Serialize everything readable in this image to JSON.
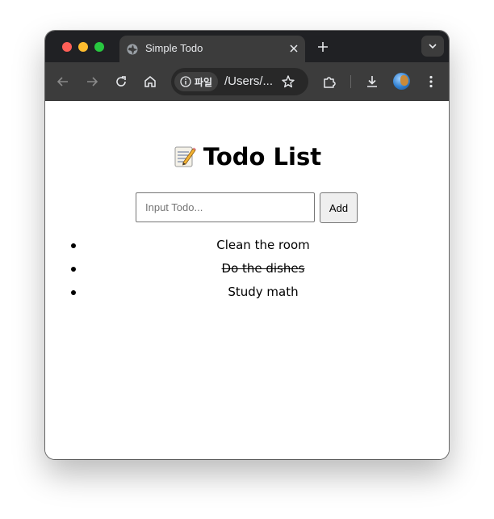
{
  "browser": {
    "tab": {
      "title": "Simple Todo"
    },
    "toolbar": {
      "site_info_label": "파일",
      "url": "/Users/..."
    }
  },
  "app": {
    "title": "Todo List",
    "title_icon": "memo-icon",
    "input": {
      "placeholder": "Input Todo...",
      "value": ""
    },
    "add_button_label": "Add",
    "todos": [
      {
        "text": "Clean the room",
        "completed": false
      },
      {
        "text": "Do the dishes",
        "completed": true
      },
      {
        "text": "Study math",
        "completed": false
      }
    ]
  }
}
